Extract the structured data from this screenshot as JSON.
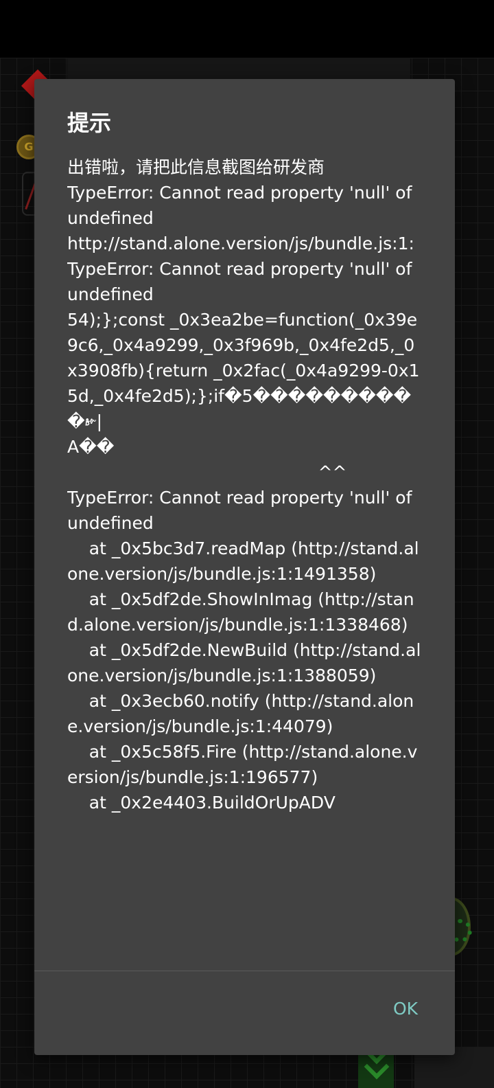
{
  "dialog": {
    "title": "提示",
    "message": "出错啦，请把此信息截图给研发商\nTypeError: Cannot read property 'null' of undefined\nhttp://stand.alone.version/js/bundle.js:1:\nTypeError: Cannot read property 'null' of undefined\n54);};const _0x3ea2be=function(_0x39e9c6,_0x4a9299,_0x3f969b,_0x4fe2d5,_0x3908fb){return _0x2fac(_0x4a9299-0x15d,_0x4fe2d5);};if�5����������𝀙|\nA��\n                                              ^^\nTypeError: Cannot read property 'null' of undefined\n    at _0x5bc3d7.readMap (http://stand.alone.version/js/bundle.js:1:1491358)\n    at _0x5df2de.ShowInImag (http://stand.alone.version/js/bundle.js:1:1338468)\n    at _0x5df2de.NewBuild (http://stand.alone.version/js/bundle.js:1:1388059)\n    at _0x3ecb60.notify (http://stand.alone.version/js/bundle.js:1:44079)\n    at _0x5c58f5.Fire (http://stand.alone.version/js/bundle.js:1:196577)\n    at _0x2e4403.BuildOrUpADV",
    "ok_label": "OK",
    "accent_color": "#7fcbc4",
    "background_color": "#424242"
  },
  "background": {
    "coin_letter": "G"
  }
}
